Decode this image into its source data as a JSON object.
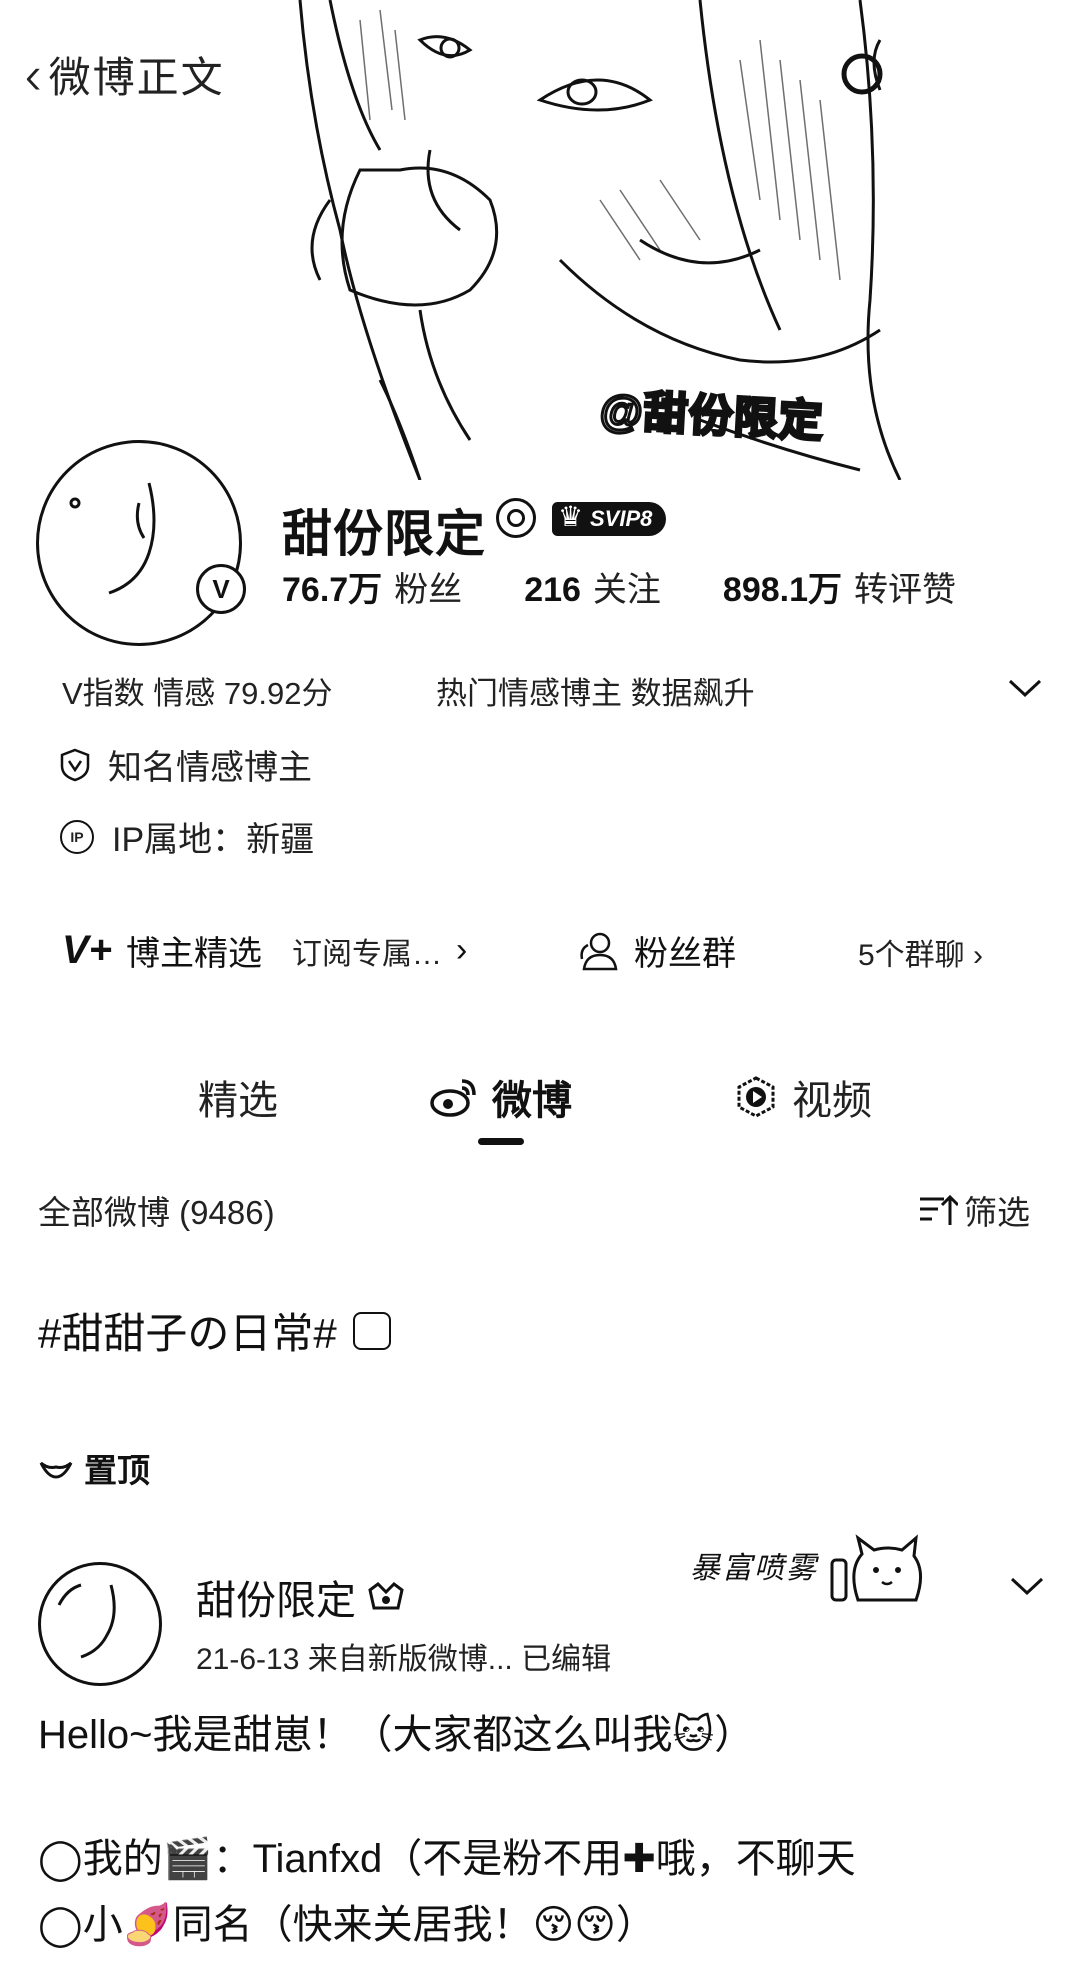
{
  "nav": {
    "back_label": "微博正文"
  },
  "cover": {
    "watermark": "@甜份限定"
  },
  "profile": {
    "name": "甜份限定",
    "membership": "SVIP8",
    "stats": [
      {
        "value": "76.7万",
        "label": "粉丝"
      },
      {
        "value": "216",
        "label": "关注"
      },
      {
        "value": "898.1万",
        "label": "转评赞"
      }
    ],
    "v_index": "V指数 情感 79.92分",
    "hot_tag": "热门情感博主 数据飙升",
    "verification": "知名情感博主",
    "ip_location": "IP属地：新疆",
    "featured_label": "博主精选",
    "featured_sub": "订阅专属…",
    "fans_group_label": "粉丝群",
    "group_chats": "5个群聊"
  },
  "tabs": [
    {
      "label": "精选"
    },
    {
      "label": "微博"
    },
    {
      "label": "视频"
    }
  ],
  "filter_bar": {
    "all_posts": "全部微博 (9486)",
    "filter_label": "筛选"
  },
  "topic": {
    "text": "#甜甜子の日常#"
  },
  "pinned": {
    "label": "置顶"
  },
  "post": {
    "author": "甜份限定",
    "meta": "21-6-13  来自新版微博...  已编辑",
    "decoration": "暴富喷雾",
    "lines": [
      "Hello~我是甜崽！（大家都这么叫我🐱）",
      "◯我的🎬：Tianfxd（不是粉不用✚哦，不聊天",
      "◯小🍠同名（快来关居我！😚😚）"
    ]
  }
}
